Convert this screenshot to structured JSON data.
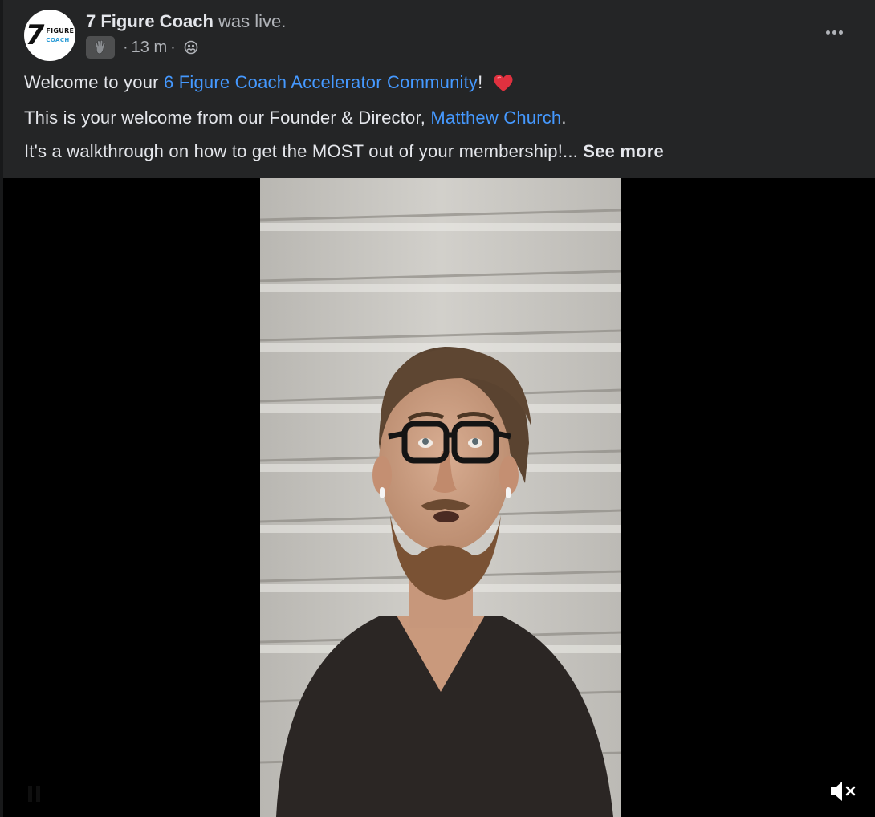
{
  "post": {
    "page_name": "7 Figure Coach",
    "status_text": "was live.",
    "time_ago": "13 m",
    "separator": "·",
    "avatar": {
      "number": "7",
      "word1": "FIGURE",
      "word2": "COACH"
    },
    "message": {
      "line1_prefix": "Welcome to your ",
      "line1_link": "6 Figure Coach Accelerator Community",
      "line1_suffix": "!",
      "line2_prefix": "This is your welcome from our Founder & Director, ",
      "line2_link": "Matthew Church",
      "line2_suffix": ".",
      "line3_text": "It's a walkthrough on how to get the MOST out of your membership!... ",
      "see_more": "See more"
    }
  },
  "icons": {
    "badge": "waving-hand-icon",
    "privacy": "group-members-icon",
    "more": "more-options-icon",
    "heart": "red-heart-emoji",
    "mute": "speaker-muted-icon"
  },
  "colors": {
    "background": "#242526",
    "link": "#4599ff",
    "secondary_text": "#b0b3b8",
    "primary_text": "#e4e6eb",
    "heart": "#e0313f"
  }
}
